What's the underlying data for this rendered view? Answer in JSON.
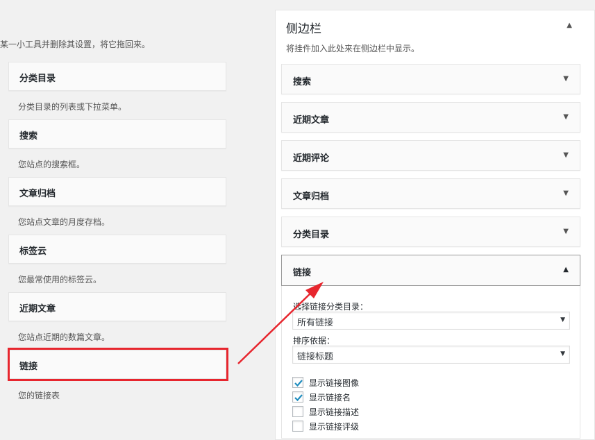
{
  "available": {
    "intro": "某一小工具并删除其设置，将它拖回来。",
    "widgets": [
      {
        "title": "分类目录",
        "desc": "分类目录的列表或下拉菜单。"
      },
      {
        "title": "搜索",
        "desc": "您站点的搜索框。"
      },
      {
        "title": "文章归档",
        "desc": "您站点文章的月度存档。"
      },
      {
        "title": "标签云",
        "desc": "您最常使用的标签云。"
      },
      {
        "title": "近期文章",
        "desc": "您站点近期的数篇文章。"
      },
      {
        "title": "链接",
        "desc": "您的链接表"
      }
    ]
  },
  "sidebar": {
    "title": "侧边栏",
    "desc": "将挂件加入此处来在侧边栏中显示。",
    "widgets": [
      {
        "title": "搜索"
      },
      {
        "title": "近期文章"
      },
      {
        "title": "近期评论"
      },
      {
        "title": "文章归档"
      },
      {
        "title": "分类目录"
      },
      {
        "title": "链接"
      }
    ],
    "links_form": {
      "category_label": "选择链接分类目录：",
      "category_value": "所有链接",
      "sort_label": "排序依据：",
      "sort_value": "链接标题",
      "checkboxes": [
        {
          "label": "显示链接图像",
          "checked": true
        },
        {
          "label": "显示链接名",
          "checked": true
        },
        {
          "label": "显示链接描述",
          "checked": false
        },
        {
          "label": "显示链接评级",
          "checked": false
        }
      ]
    }
  },
  "colors": {
    "highlight": "#e7262e",
    "check": "#1e8cbe"
  }
}
